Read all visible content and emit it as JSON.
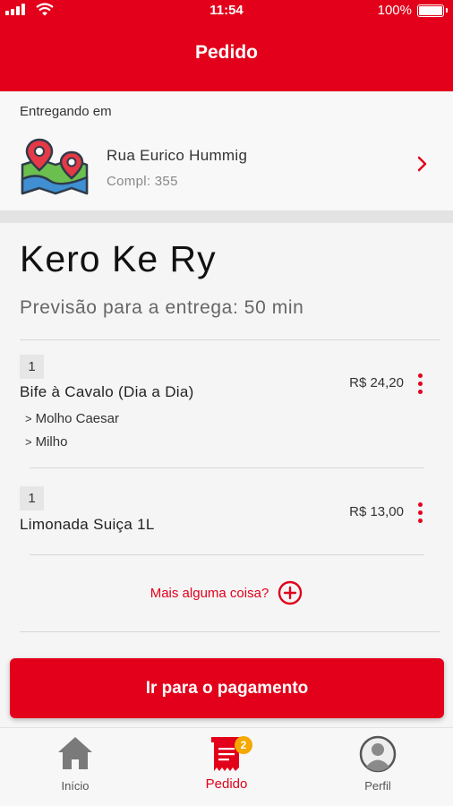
{
  "status_bar": {
    "time": "11:54",
    "battery": "100%"
  },
  "header": {
    "title": "Pedido"
  },
  "address": {
    "label": "Entregando em",
    "street": "Rua Eurico Hummig",
    "complement": "Compl: 355"
  },
  "store": {
    "name": "Kero Ke Ry",
    "eta": "Previsão para a entrega: 50 min"
  },
  "items": [
    {
      "qty": "1",
      "name": "Bife à Cavalo (Dia a Dia)",
      "price": "R$ 24,20",
      "addons": [
        "Molho Caesar",
        "Milho"
      ]
    },
    {
      "qty": "1",
      "name": "Limonada Suiça 1L",
      "price": "R$ 13,00",
      "addons": []
    }
  ],
  "add_more": {
    "label": "Mais alguma coisa?"
  },
  "pay_button": {
    "label": "Ir para o pagamento"
  },
  "tabs": [
    {
      "label": "Início",
      "icon": "home-icon",
      "active": false
    },
    {
      "label": "Pedido",
      "icon": "receipt-icon",
      "active": true,
      "badge": "2"
    },
    {
      "label": "Perfil",
      "icon": "user-avatar-icon",
      "active": false
    }
  ],
  "colors": {
    "brand": "#e2001a",
    "badge": "#f5a800"
  }
}
